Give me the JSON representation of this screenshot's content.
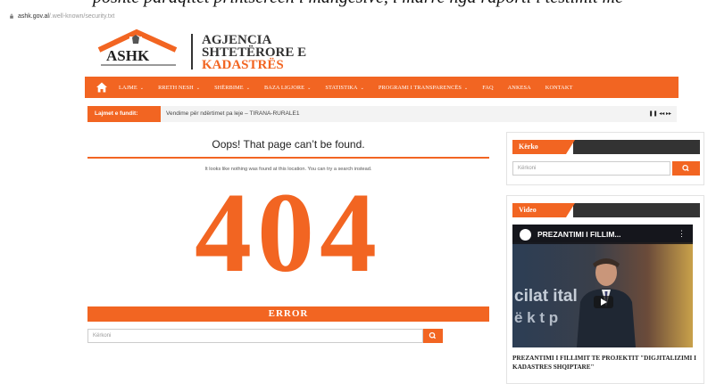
{
  "caption": "poshte paraqitet printscreen i mangesive, i marre nga raporti i testimit me",
  "browser": {
    "url_host": "ashk.gov.al",
    "url_path": "/.well-known/security.txt"
  },
  "header": {
    "logo_text": "ASHK",
    "org_line1": "AGJENCIA",
    "org_line2": "SHTETËRORE E",
    "org_line3": "KADASTRËS"
  },
  "nav": {
    "items": [
      {
        "label": "LAJME",
        "caret": true
      },
      {
        "label": "RRETH NESH",
        "caret": true
      },
      {
        "label": "SHËRBIME",
        "caret": true
      },
      {
        "label": "BAZA LIGJORE",
        "caret": true
      },
      {
        "label": "STATISTIKA",
        "caret": true
      },
      {
        "label": "PROGRAMI I TRANSPARENCËS",
        "caret": true
      },
      {
        "label": "FAQ",
        "caret": false
      },
      {
        "label": "ANKESA",
        "caret": false
      },
      {
        "label": "KONTAKT",
        "caret": false
      }
    ]
  },
  "ticker": {
    "label": "Lajmet e fundit:",
    "text": "Vendime për ndërtimet pa leje – TIRANA-RURALE1",
    "controls": "❚❚ ◂◂ ▸▸"
  },
  "main": {
    "title": "Oops! That page can’t be found.",
    "message": "It looks like nothing was found at this location. You can try a search instead.",
    "code": "404",
    "error_label": "ERROR",
    "search_placeholder": "Kërkoni"
  },
  "sidebar": {
    "search_title": "Kërko",
    "search_placeholder": "Kërkoni",
    "video_title": "Video",
    "video_player_title": "PREZANTIMI I FILLIM...",
    "video_overlay_line1": "cilat      ital",
    "video_overlay_line2": "ë k          t p",
    "video_caption": "PREZANTIMI I FILLIMIT TE PROJEKTIT \"DIGJITALIZIMI I KADASTRES SHQIPTARE\""
  },
  "colors": {
    "accent": "#f26522",
    "dark": "#333333"
  },
  "icons": [
    "lock-icon",
    "home-icon",
    "search-icon",
    "pause-icon",
    "prev-icon",
    "next-icon",
    "play-icon",
    "more-options-icon"
  ]
}
